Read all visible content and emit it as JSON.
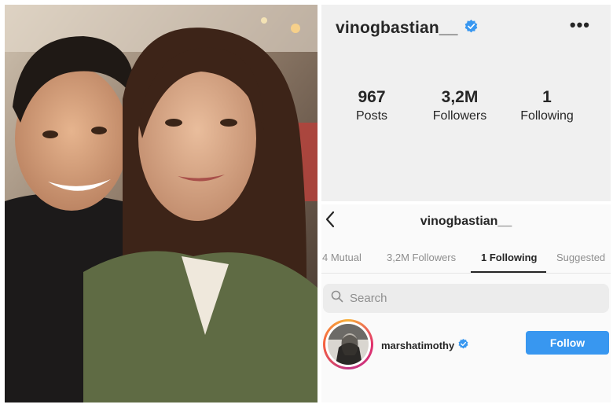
{
  "profile": {
    "username": "vinogbastian__",
    "stats": [
      {
        "value": "967",
        "label": "Posts"
      },
      {
        "value": "3,2M",
        "label": "Followers"
      },
      {
        "value": "1",
        "label": "Following"
      }
    ],
    "more_icon": "more-horizontal-icon",
    "verified_icon": "verified-badge-icon"
  },
  "following_page": {
    "username": "vinogbastian__",
    "back_icon": "chevron-left-icon",
    "tabs": [
      {
        "label": "4 Mutual",
        "active": false
      },
      {
        "label": "3,2M Followers",
        "active": false
      },
      {
        "label": "1 Following",
        "active": true
      },
      {
        "label": "Suggested",
        "active": false
      }
    ],
    "search": {
      "placeholder": "Search",
      "icon": "search-icon"
    },
    "users": [
      {
        "username": "marshatimothy",
        "verified": true,
        "button_label": "Follow"
      }
    ]
  },
  "colors": {
    "verified": "#3897f0",
    "follow_button": "#3897f0",
    "profile_bg": "#f0f0f0"
  }
}
